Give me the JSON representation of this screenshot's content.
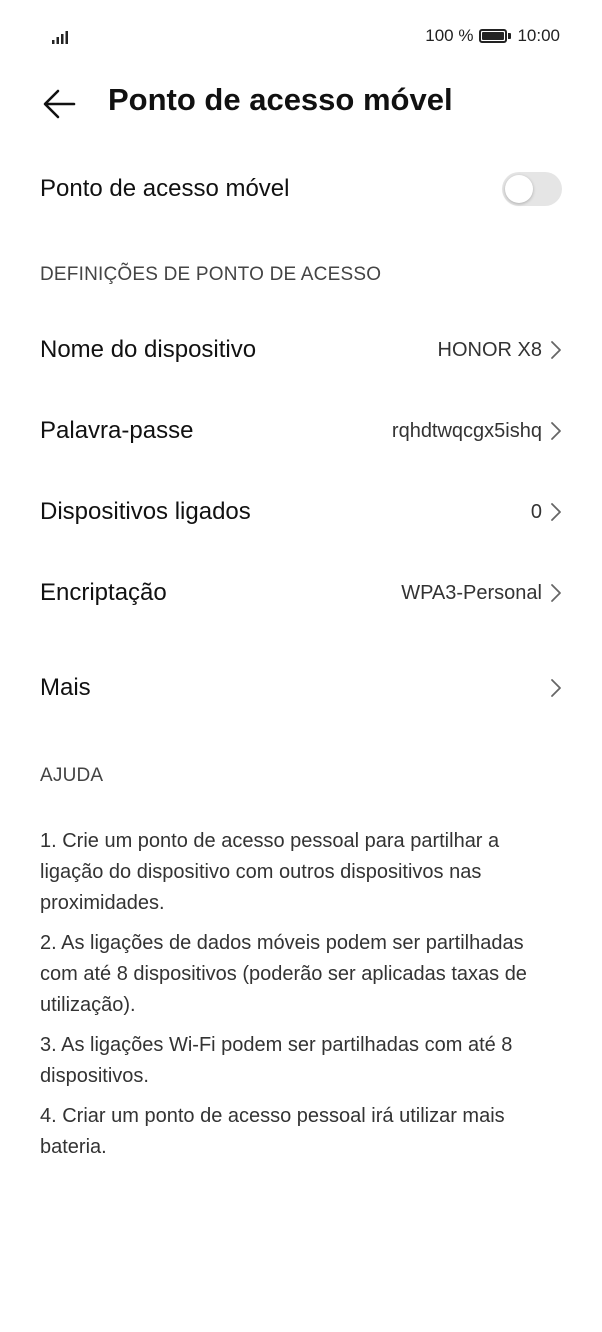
{
  "status_bar": {
    "battery_text": "100 %",
    "time": "10:00",
    "signal_icon": "signal-bars-icon",
    "battery_icon": "battery-full-icon"
  },
  "header": {
    "title": "Ponto de acesso móvel",
    "back_icon": "back-arrow-icon"
  },
  "hotspot_toggle": {
    "label": "Ponto de acesso móvel",
    "state": "off"
  },
  "settings_section": {
    "title": "DEFINIÇÕES DE PONTO DE ACESSO",
    "items": [
      {
        "label": "Nome do dispositivo",
        "value": "HONOR X8"
      },
      {
        "label": "Palavra-passe",
        "value": "rqhdtwqcgx5ishq"
      },
      {
        "label": "Dispositivos ligados",
        "value": "0"
      },
      {
        "label": "Encriptação",
        "value": "WPA3-Personal"
      },
      {
        "label": "Mais",
        "value": ""
      }
    ]
  },
  "help_section": {
    "title": "AJUDA",
    "items": [
      "1. Crie um ponto de acesso pessoal para partilhar a ligação do dispositivo com outros dispositivos nas proximidades.",
      "2. As ligações de dados móveis podem ser partilhadas com até 8 dispositivos (poderão ser aplicadas taxas de utilização).",
      "3. As ligações Wi-Fi podem ser partilhadas com até 8 dispositivos.",
      "4. Criar um ponto de acesso pessoal irá utilizar mais bateria."
    ]
  },
  "colors": {
    "background": "#ffffff",
    "text_primary": "#111111",
    "text_secondary": "#444444",
    "toggle_off": "#e5e5e5"
  }
}
